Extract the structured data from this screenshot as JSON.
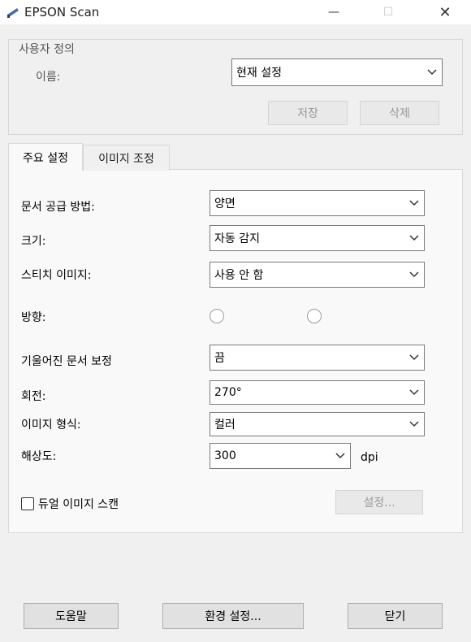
{
  "window": {
    "title": "EPSON Scan",
    "minimize_glyph": "—",
    "maximize_glyph": "☐",
    "close_glyph": "✕"
  },
  "user_defined": {
    "group_title": "사용자 정의",
    "name_label": "이름:",
    "name_value": "현재 설정",
    "save_label": "저장",
    "delete_label": "삭제"
  },
  "tabs": [
    {
      "label": "주요 설정",
      "active": true
    },
    {
      "label": "이미지 조정",
      "active": false
    }
  ],
  "main_settings": {
    "document_source_label": "문서 공급 방법:",
    "document_source_value": "양면",
    "size_label": "크기:",
    "size_value": "자동 감지",
    "stitch_label": "스티치 이미지:",
    "stitch_value": "사용 안 함",
    "orientation_label": "방향:",
    "skew_label": "기울어진 문서 보정",
    "skew_value": "끔",
    "rotation_label": "회전:",
    "rotation_value": "270°",
    "image_type_label": "이미지 형식:",
    "image_type_value": "컬러",
    "resolution_label": "해상도:",
    "resolution_value": "300",
    "resolution_unit": "dpi",
    "dual_image_label": "듀얼 이미지 스캔",
    "dual_image_checked": false,
    "settings_button_label": "설정..."
  },
  "footer": {
    "help_label": "도움말",
    "preferences_label": "환경 설정...",
    "close_label": "닫기"
  },
  "icons": {
    "app": "scanner-icon",
    "dropdown": "chevron-down-icon"
  }
}
